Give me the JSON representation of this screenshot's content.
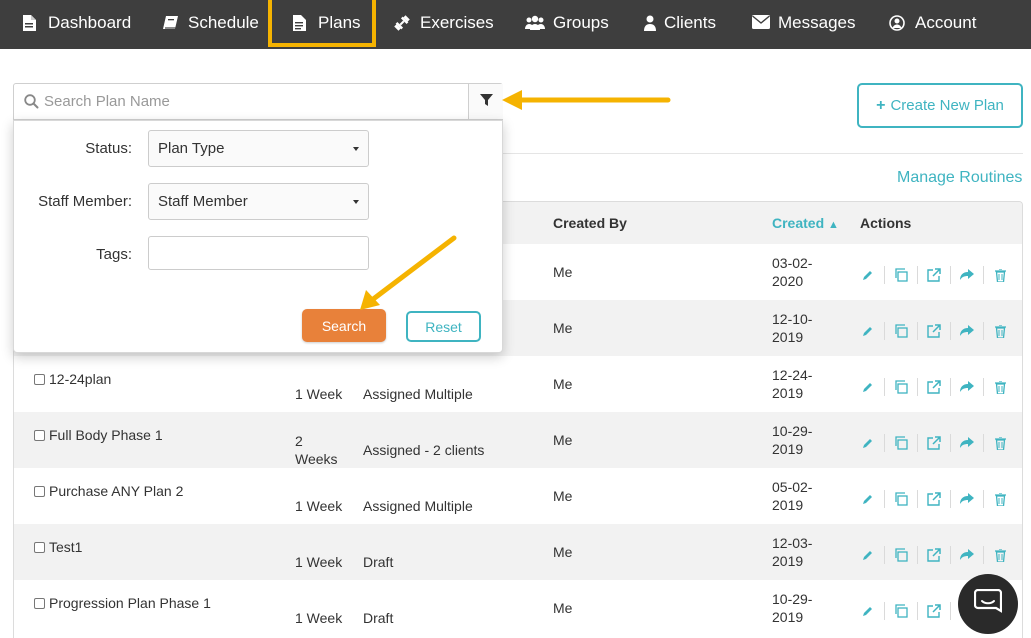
{
  "nav": {
    "items": [
      {
        "label": "Dashboard",
        "icon": "file-icon"
      },
      {
        "label": "Schedule",
        "icon": "book-icon"
      },
      {
        "label": "Plans",
        "icon": "document-icon"
      },
      {
        "label": "Exercises",
        "icon": "dumbbell-icon"
      },
      {
        "label": "Groups",
        "icon": "users-icon"
      },
      {
        "label": "Clients",
        "icon": "user-icon"
      },
      {
        "label": "Messages",
        "icon": "envelope-icon"
      },
      {
        "label": "Account",
        "icon": "user-circle-icon"
      }
    ]
  },
  "search": {
    "placeholder": "Search Plan Name"
  },
  "create_button": {
    "label": "Create New Plan"
  },
  "manage_link": "Manage Routines",
  "filter_panel": {
    "status_label": "Status:",
    "status_value": "Plan Type",
    "staff_label": "Staff Member:",
    "staff_value": "Staff Member",
    "tags_label": "Tags:",
    "tags_value": "",
    "search_label": "Search",
    "reset_label": "Reset"
  },
  "table": {
    "headers": {
      "created_by": "Created By",
      "created": "Created",
      "actions": "Actions"
    },
    "rows": [
      {
        "name": "",
        "duration": "",
        "status": "",
        "created_by": "Me",
        "created": "03-02-\n2020"
      },
      {
        "name": "",
        "duration": "",
        "status": "",
        "created_by": "Me",
        "created": "12-10-\n2019"
      },
      {
        "name": "12-24plan",
        "duration": "1 Week",
        "status": "Assigned Multiple",
        "created_by": "Me",
        "created": "12-24-\n2019"
      },
      {
        "name": "Full Body Phase 1",
        "duration": "2\nWeeks",
        "status": "Assigned - 2 clients",
        "created_by": "Me",
        "created": "10-29-\n2019"
      },
      {
        "name": "Purchase ANY Plan 2",
        "duration": "1 Week",
        "status": "Assigned Multiple",
        "created_by": "Me",
        "created": "05-02-\n2019"
      },
      {
        "name": "Test1",
        "duration": "1 Week",
        "status": "Draft",
        "created_by": "Me",
        "created": "12-03-\n2019"
      },
      {
        "name": "Progression Plan Phase 1",
        "duration": "1 Week",
        "status": "Draft",
        "created_by": "Me",
        "created": "10-29-\n2019"
      }
    ]
  },
  "colors": {
    "accent": "#3fb4c1",
    "orange": "#e8813a",
    "highlight": "#f5b301",
    "nav_bg": "#3e3e3e"
  }
}
